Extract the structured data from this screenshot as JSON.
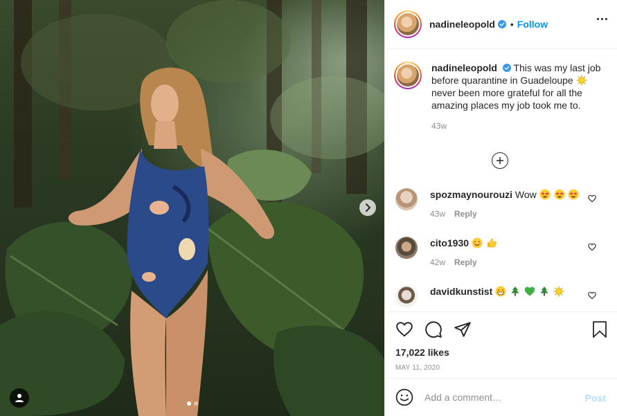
{
  "post": {
    "author": "nadineleopold",
    "follow_separator": "•",
    "follow_label": "Follow",
    "caption_text_1": "This was my last job before quarantine in Guadeloupe",
    "caption_text_2": "never been more grateful for all the amazing places my job took me to.",
    "caption_time": "43w",
    "photo_count": 2,
    "photo_index": 1
  },
  "comments": [
    {
      "username": "spozmaynourouzi",
      "text": "Wow",
      "emoji": [
        "star-struck",
        "star-struck",
        "star-struck"
      ],
      "time": "43w",
      "reply_label": "Reply"
    },
    {
      "username": "cito1930",
      "text": "",
      "emoji": [
        "smiling-face",
        "thumbs-up"
      ],
      "time": "42w",
      "reply_label": "Reply"
    },
    {
      "username": "davidkunstist",
      "text": "",
      "emoji": [
        "grinning-face",
        "evergreen-tree",
        "green-heart",
        "evergreen-tree",
        "sun"
      ],
      "time": "",
      "reply_label": ""
    }
  ],
  "actions": {
    "likes": "17,022 likes",
    "date": "MAY 11, 2020"
  },
  "composer": {
    "placeholder": "Add a comment…",
    "post_label": "Post"
  },
  "colors": {
    "link_blue": "#0095f6",
    "post_disabled": "#b2dffc",
    "muted_text": "#8e8e8e",
    "text": "#262626",
    "verified_blue": "#3897f0"
  }
}
